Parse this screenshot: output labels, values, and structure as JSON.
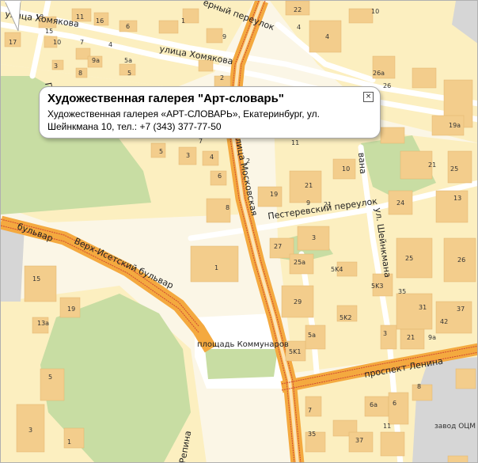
{
  "balloon": {
    "title": "Художественная галерея \"Арт-словарь\"",
    "line1": "Художественная галерея «АРТ-СЛОВАРЬ», Екатеринбург, ул.",
    "line2": "Шейнкмана 10, тел.: +7 (343) 377-77-50",
    "close": "×"
  },
  "streets": {
    "khomyakova_top": "улица Хомякова",
    "khomyakova": "улица Хомякова",
    "pereulok_top": "ерный переулок",
    "garin": "Гари",
    "moskovskaya": "улица Московская",
    "pesterevsky": "Пестеревский переулок",
    "sheinkmana_upper": "вана",
    "sheinkmana": "ул. Шейнкмана",
    "verkh_isetsky": "Верх-Исетский бульвар",
    "verkh_isetsky_left": "бульвар",
    "lenina": "проспект Ленина",
    "repina": "Репина",
    "square": "площадь Коммунаров",
    "zavod": "завод ОЦМ"
  },
  "buildings": [
    "13",
    "11",
    "15",
    "16",
    "6",
    "1",
    "17",
    "10",
    "7",
    "4",
    "9",
    "9a",
    "3",
    "8",
    "5",
    "5a",
    "2",
    "22",
    "4",
    "26a",
    "4",
    "10",
    "26",
    "19a",
    "11",
    "5",
    "3",
    "4",
    "6",
    "7",
    "2",
    "21",
    "19",
    "21",
    "10",
    "25",
    "24",
    "13",
    "21",
    "9",
    "8",
    "27",
    "3",
    "25",
    "26",
    "1",
    "5K4",
    "25a",
    "15",
    "19",
    "29",
    "5K3",
    "35",
    "31",
    "13a",
    "5K2",
    "37",
    "42",
    "5a",
    "5K1",
    "3",
    "9a",
    "21",
    "5",
    "8",
    "3",
    "6a",
    "6",
    "35",
    "37",
    "11",
    "7",
    "1"
  ],
  "colors": {
    "background": "#fbf6e6",
    "block": "#fcefc0",
    "building": "#f3cd8c",
    "main_road": "#f4a93f",
    "park": "#c8dda3",
    "industrial": "#d6d6d6",
    "minor_road": "#ffffff",
    "tram": "#d04a32"
  }
}
